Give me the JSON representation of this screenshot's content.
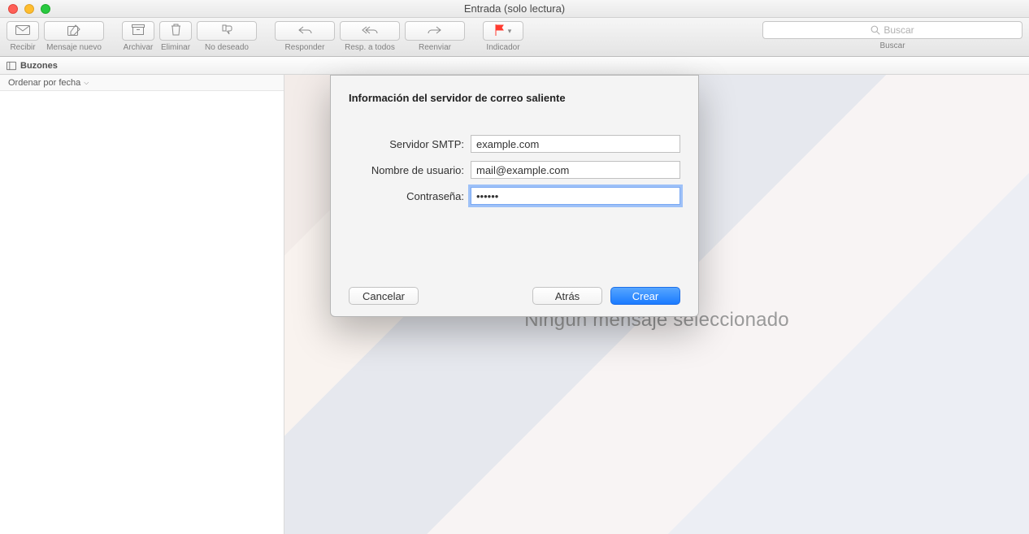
{
  "window": {
    "title": "Entrada (solo lectura)"
  },
  "toolbar": {
    "recibir": "Recibir",
    "nuevo": "Mensaje nuevo",
    "archivar": "Archivar",
    "eliminar": "Eliminar",
    "no_deseado": "No deseado",
    "responder": "Responder",
    "responder_todos": "Resp. a todos",
    "reenviar": "Reenviar",
    "indicador": "Indicador",
    "search_placeholder": "Buscar",
    "search_label": "Buscar"
  },
  "favbar": {
    "buzones": "Buzones"
  },
  "sidebar": {
    "sort_label": "Ordenar por fecha"
  },
  "main": {
    "empty": "Ningún mensaje seleccionado"
  },
  "modal": {
    "title": "Información del servidor de correo saliente",
    "smtp_label": "Servidor SMTP:",
    "smtp_value": "example.com",
    "user_label": "Nombre de usuario:",
    "user_value": "mail@example.com",
    "pass_label": "Contraseña:",
    "pass_value": "••••••",
    "cancel": "Cancelar",
    "back": "Atrás",
    "create": "Crear"
  }
}
